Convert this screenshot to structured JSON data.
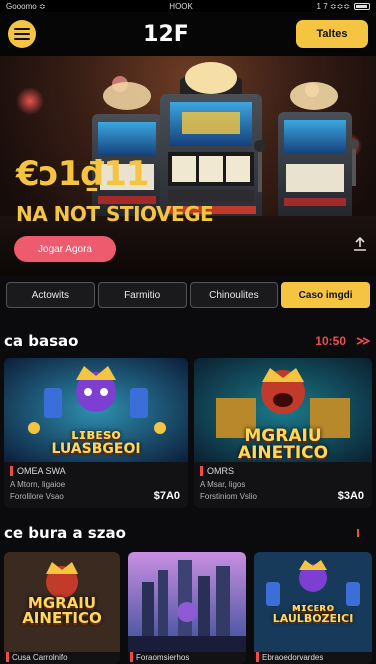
{
  "status_bar": {
    "left": "Gooomo ≎",
    "center": "HOOK",
    "right": "1 7 ≎≎≎"
  },
  "header": {
    "logo": "12F",
    "cta_label": "Taltes"
  },
  "hero": {
    "title": "€ɔ1₫11",
    "subtitle": "NA NOT STIOVEGE",
    "cta_label": "Jogar Agora"
  },
  "tabs": [
    {
      "label": "Actowits",
      "active": false
    },
    {
      "label": "Farmitio",
      "active": false
    },
    {
      "label": "Chinoulites",
      "active": false
    },
    {
      "label": "Caso imgdi",
      "active": true
    }
  ],
  "section1": {
    "title": "ca basao",
    "count": "10:50"
  },
  "cards": [
    {
      "game": "ʟɪʙᴇꜱᴏ\nLUASBGEOI",
      "name": "OMEA SWA",
      "sub1": "A Mtorn, ligaioe",
      "sub2": "Forolilore Vsao",
      "price": "$7A0"
    },
    {
      "game": "MGRAIU\nAINETICO",
      "name": "OMRS",
      "sub1": "A Msar, ligos",
      "sub2": "Forstiniom Vslio",
      "price": "$3A0"
    }
  ],
  "section2": {
    "title": "ce bura a szao"
  },
  "small_cards": [
    {
      "game": "MGRAIU\nAINETICO",
      "label": "Cusa Carrolnifo"
    },
    {
      "game": "",
      "label": "Foraomsierhos"
    },
    {
      "game": "ᴍɪᴄᴇʀᴏ\nLAULBOZEICI",
      "label": "Ebraoedorvardes"
    }
  ],
  "colors": {
    "accent": "#f5c542",
    "hero_cta": "#ee5a6e",
    "alert": "#ee4b4b",
    "background": "#0b0b0d"
  }
}
